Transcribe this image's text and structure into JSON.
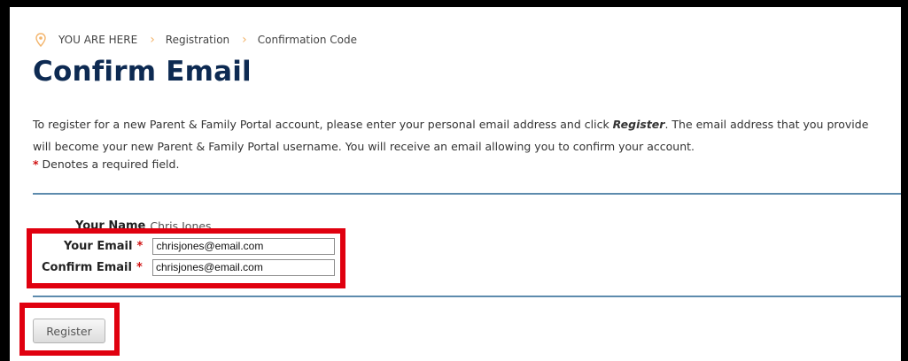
{
  "breadcrumb": {
    "prefix": "YOU ARE HERE",
    "items": [
      "Registration",
      "Confirmation Code"
    ]
  },
  "page": {
    "title": "Confirm Email",
    "intro_before": "To register for a new Parent & Family Portal account, please enter your personal email address and click ",
    "intro_keyword": "Register",
    "intro_after": ". The email address that you provide will become your new Parent & Family Portal username. You will receive an email allowing you to confirm your account.",
    "required_star": "*",
    "required_note": "Denotes a required field."
  },
  "form": {
    "name_label": "Your Name",
    "name_value": "Chris Jones",
    "email_label": "Your Email",
    "email_value": "chrisjones@email.com",
    "confirm_label": "Confirm Email",
    "confirm_value": "chrisjones@email.com"
  },
  "actions": {
    "register_label": "Register"
  },
  "icons": {
    "location": "map-pin-icon",
    "separator": "chevron-right-icon"
  },
  "colors": {
    "title": "#0d2a52",
    "divider": "#5d8bad",
    "required": "#d01010",
    "highlight": "#e0000f",
    "breadcrumb_accent": "#f3b46b"
  }
}
